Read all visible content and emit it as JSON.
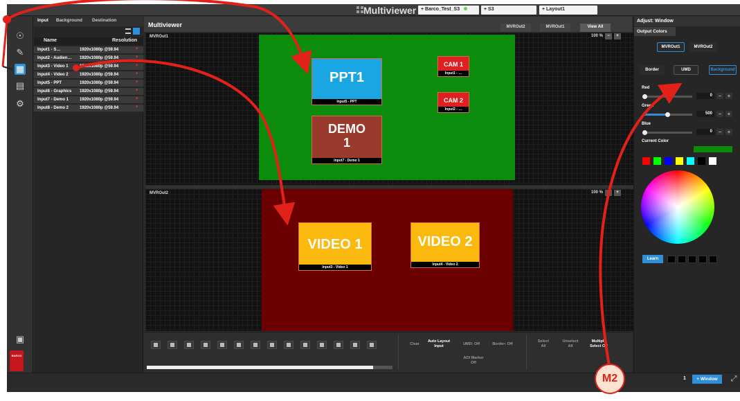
{
  "titlebar": {
    "title": "Multiviewer",
    "tabs": [
      "+ Barco_Test_S3",
      "+ S3",
      "+ Layout1"
    ]
  },
  "iconbar": {
    "items": [
      "users-icon",
      "edit-icon",
      "layout-icon",
      "display-icon",
      "gear-icon"
    ],
    "save": "save-icon",
    "logo": "BARCO"
  },
  "input_panel": {
    "tabs": [
      "Input",
      "Background",
      "Destination"
    ],
    "columns": [
      "Name",
      "Resolution"
    ],
    "rows": [
      {
        "name": "Input1 - S…",
        "res": "1920x1080p @59.94"
      },
      {
        "name": "Input2 - Audien…",
        "res": "1920x1080p @59.94"
      },
      {
        "name": "Input3 - Video 1",
        "res": "1920x1080p @59.94"
      },
      {
        "name": "Input4 - Video 2",
        "res": "1920x1080p @59.94"
      },
      {
        "name": "Input5 - PPT",
        "res": "1920x1080p @59.94"
      },
      {
        "name": "Input6 - Graphics",
        "res": "1920x1080p @59.94"
      },
      {
        "name": "Input7 - Demo 1",
        "res": "1920x1080p @59.94"
      },
      {
        "name": "Input8 - Demo 2",
        "res": "1920x1080p @59.94"
      }
    ],
    "status_mark": "*"
  },
  "multiviewer": {
    "title": "Multiviewer",
    "view_tabs": [
      "MVROut2",
      "MVROut1",
      "View All"
    ],
    "out1": {
      "label": "MVROut1",
      "zoom": "100 %",
      "windows": [
        {
          "big": "PPT1",
          "cap": "Input5 - PPT"
        },
        {
          "big": "CAM 1",
          "cap": "Input1 - …"
        },
        {
          "big": "CAM 2",
          "cap": "Input2 - …"
        },
        {
          "big": "DEMO 1",
          "cap": "Input7 - Demo 1"
        }
      ]
    },
    "out2": {
      "label": "MVROut2",
      "zoom": "100 %",
      "windows": [
        {
          "big": "VIDEO 1",
          "cap": "Input3 - Video 1"
        },
        {
          "big": "VIDEO 2",
          "cap": "Input4 - Video 2"
        }
      ]
    }
  },
  "toolbar": {
    "clear": "Clear",
    "auto_layout": "Auto Layout Input",
    "umd": "UMD: Off",
    "border": "Border: Off",
    "aoi": "AOI Marker Off",
    "select_all": "Select All",
    "unselect_all": "Unselect All",
    "multiple_select": "Multiple Select Off",
    "progress": 0.92
  },
  "right_panel": {
    "header": "Adjust: Window",
    "sub": "Output Colors",
    "outputs": [
      "MVROut1",
      "MVROut2"
    ],
    "modes": [
      "Border",
      "UMD",
      "Background"
    ],
    "red_label": "Red",
    "green_label": "Green",
    "blue_label": "Blue",
    "red_value": "0",
    "green_value": "500",
    "blue_value": "0",
    "green_fraction": 0.49,
    "current_color_label": "Current Color",
    "current_color": "#0b8a0b",
    "swatches": [
      "#ff0000",
      "#00ff00",
      "#0000ff",
      "#ffff00",
      "#00ffff",
      "#000000",
      "#ffffff"
    ],
    "learn": "Learn"
  },
  "statusbar": {
    "page": "1",
    "add_window": "+ Window"
  },
  "callout": "M2"
}
